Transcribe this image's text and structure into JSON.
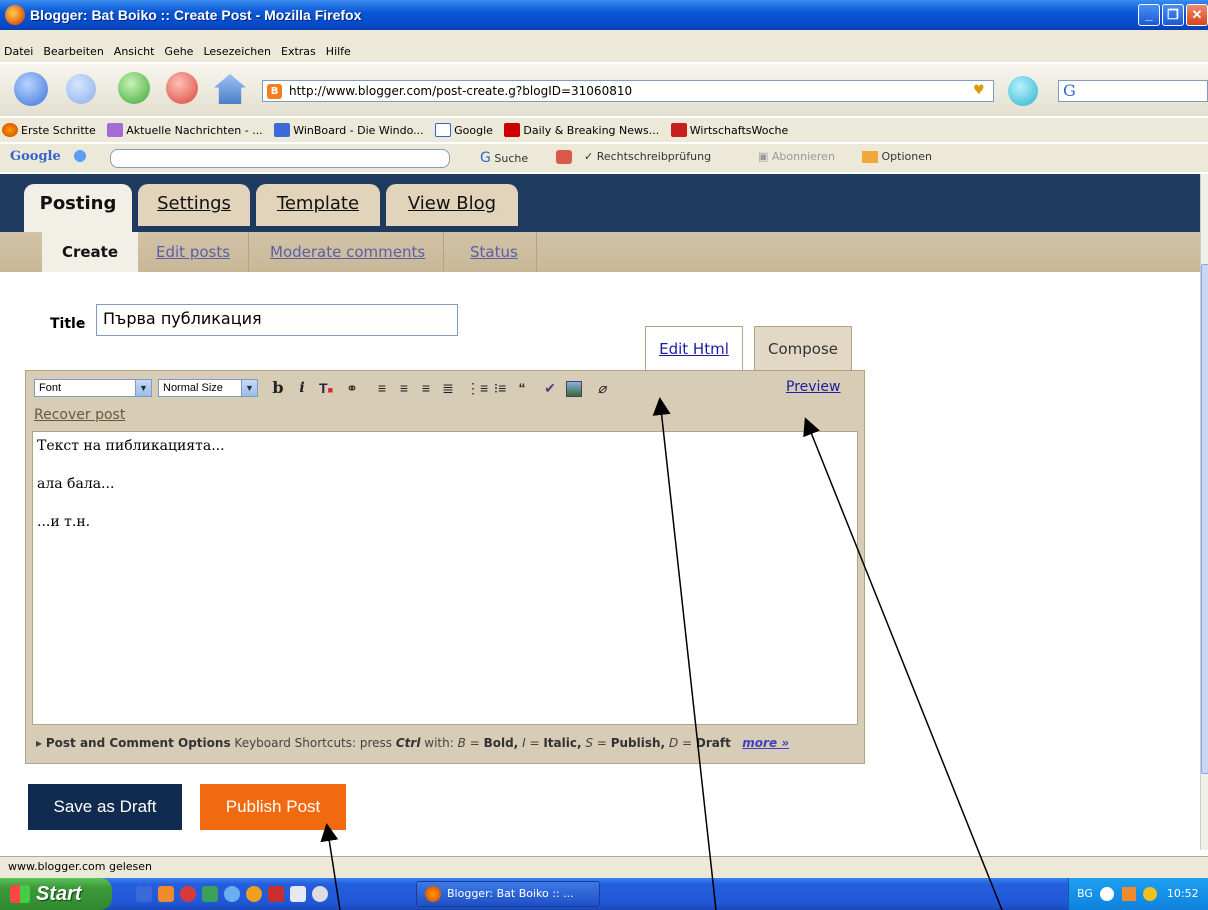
{
  "window": {
    "title": "Blogger: Bat Boiko :: Create Post - Mozilla Firefox"
  },
  "menu": [
    "Datei",
    "Bearbeiten",
    "Ansicht",
    "Gehe",
    "Lesezeichen",
    "Extras",
    "Hilfe"
  ],
  "nav": {
    "url": "http://www.blogger.com/post-create.g?blogID=31060810",
    "go_box_value": "G"
  },
  "bookmarks": [
    "Erste Schritte",
    "Aktuelle Nachrichten - ...",
    "WinBoard - Die Windo...",
    "Google",
    "Daily & Breaking News...",
    "WirtschaftsWoche"
  ],
  "google_toolbar": {
    "logo": "Google",
    "search_label": "Suche",
    "spellcheck_label": "Rechtschreibprüfung",
    "subscribe_label": "Abonnieren",
    "options_label": "Optionen"
  },
  "blogger": {
    "tabs": [
      "Posting",
      "Settings",
      "Template",
      "View Blog"
    ],
    "subtabs": [
      "Create",
      "Edit posts",
      "Moderate comments",
      "Status"
    ],
    "title_label": "Title",
    "title_colon": ":",
    "title_value": "Първа публикация",
    "mode_tabs": {
      "edit_html": "Edit Html",
      "compose": "Compose"
    },
    "font_select": "Font",
    "size_select": "Normal Size",
    "preview_label": "Preview",
    "recover_label": "Recover post",
    "body_lines": [
      "Текст на пибликацията...",
      "ала бала...",
      "...и т.н."
    ],
    "options": {
      "title": "Post and Comment Options",
      "shortcuts": "Keyboard Shortcuts: press",
      "ctrl": "Ctrl",
      "with": "with:",
      "b_key": "B",
      "b_action": "Bold,",
      "i_key": "I",
      "i_action": "Italic,",
      "s_key": "S",
      "s_action": "Publish,",
      "d_key": "D",
      "d_action": "Draft",
      "eq": "=",
      "more": "more »"
    },
    "save_draft": "Save as Draft",
    "publish": "Publish Post"
  },
  "status_text": "www.blogger.com gelesen",
  "taskbar": {
    "start": "Start",
    "window_button": "Blogger: Bat Boiko :: ...",
    "lang": "BG",
    "clock": "10:52"
  },
  "colors": {
    "tab_bar": "#1e3b5f",
    "publish": "#f26a10",
    "draft": "#112a50"
  }
}
